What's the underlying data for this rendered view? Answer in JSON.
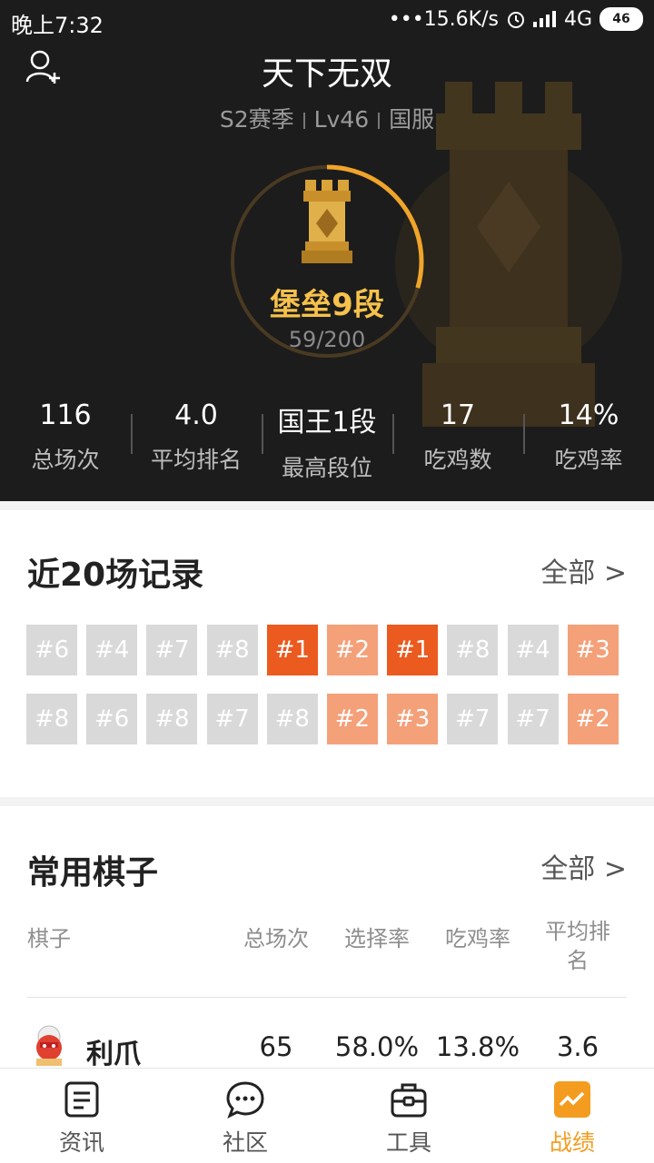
{
  "status_bar": {
    "time": "晚上7:32",
    "network_speed": "•••15.6K/s",
    "network_type": "4G",
    "battery": "46"
  },
  "header": {
    "player_name": "天下无双",
    "season": "S2赛季",
    "level": "Lv46",
    "server": "国服",
    "rank_name": "堡垒9段",
    "rank_progress_text": "59/200",
    "rank_progress_fraction": 0.295,
    "accent_color": "#f6c24b"
  },
  "stats": [
    {
      "value": "116",
      "label": "总场次"
    },
    {
      "value": "4.0",
      "label": "平均排名"
    },
    {
      "value": "国王1段",
      "label": "最高段位"
    },
    {
      "value": "17",
      "label": "吃鸡数"
    },
    {
      "value": "14%",
      "label": "吃鸡率"
    }
  ],
  "recent": {
    "title": "近20场记录",
    "more_label": "全部 >",
    "rows": [
      [
        {
          "label": "#6",
          "style": "gray"
        },
        {
          "label": "#4",
          "style": "gray"
        },
        {
          "label": "#7",
          "style": "gray"
        },
        {
          "label": "#8",
          "style": "gray"
        },
        {
          "label": "#1",
          "style": "dark"
        },
        {
          "label": "#2",
          "style": "light"
        },
        {
          "label": "#1",
          "style": "dark"
        },
        {
          "label": "#8",
          "style": "gray"
        },
        {
          "label": "#4",
          "style": "gray"
        },
        {
          "label": "#3",
          "style": "light"
        }
      ],
      [
        {
          "label": "#8",
          "style": "gray"
        },
        {
          "label": "#6",
          "style": "gray"
        },
        {
          "label": "#8",
          "style": "gray"
        },
        {
          "label": "#7",
          "style": "gray"
        },
        {
          "label": "#8",
          "style": "gray"
        },
        {
          "label": "#2",
          "style": "light"
        },
        {
          "label": "#3",
          "style": "light"
        },
        {
          "label": "#7",
          "style": "gray"
        },
        {
          "label": "#7",
          "style": "gray"
        },
        {
          "label": "#2",
          "style": "light"
        }
      ]
    ],
    "colors": {
      "first_place": "#eb5a1e",
      "top_three": "#f4a079",
      "other": "#d9d9d9"
    }
  },
  "pieces": {
    "title": "常用棋子",
    "more_label": "全部 >",
    "columns": [
      "棋子",
      "总场次",
      "选择率",
      "吃鸡率",
      "平均排\n名"
    ],
    "rows": [
      {
        "name": "利爪",
        "avatar_icon": "character-avatar",
        "games": "65",
        "pick_rate": "58.0%",
        "win_rate": "13.8%",
        "avg_rank": "3.6"
      }
    ]
  },
  "bottom_nav": [
    {
      "label": "资讯",
      "icon": "news-icon",
      "active": false
    },
    {
      "label": "社区",
      "icon": "chat-icon",
      "active": false
    },
    {
      "label": "工具",
      "icon": "toolbox-icon",
      "active": false
    },
    {
      "label": "战绩",
      "icon": "stats-chart-icon",
      "active": true
    }
  ]
}
